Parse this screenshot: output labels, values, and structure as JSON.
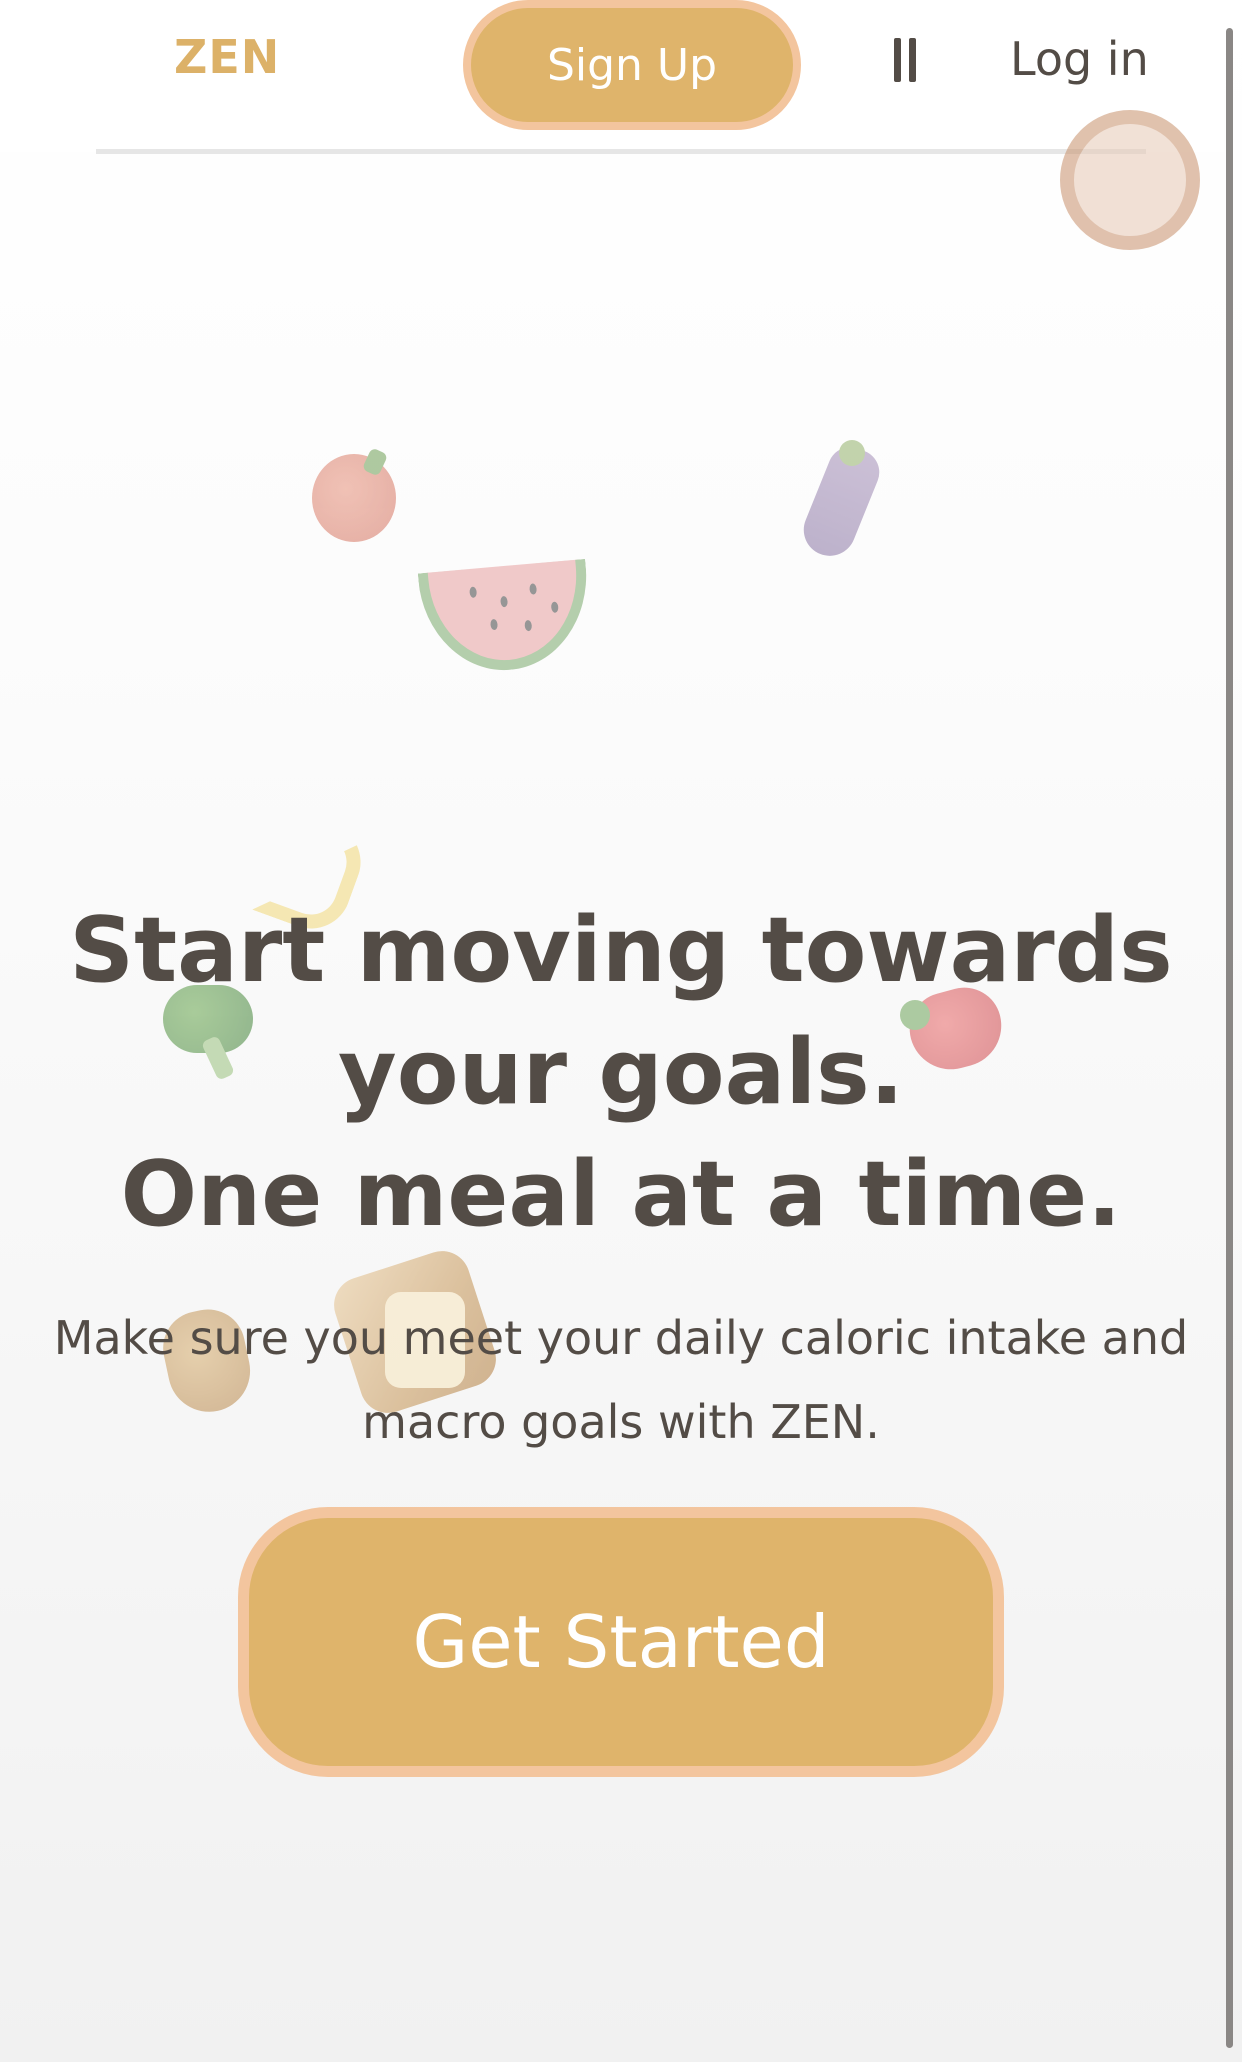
{
  "header": {
    "brand": "ZEN",
    "signup_label": "Sign Up",
    "login_label": "Log in"
  },
  "hero": {
    "title_line1": "Start moving towards",
    "title_line2": "your goals.",
    "title_line3": "One meal at a time.",
    "subtitle": "Make sure you meet your daily caloric intake and macro goals with ZEN.",
    "cta_label": "Get Started"
  },
  "icons": {
    "pause": "pause-icon",
    "foods": [
      "donut",
      "tomato",
      "eggplant",
      "watermelon",
      "banana",
      "broccoli",
      "strawberry",
      "potato",
      "bread"
    ]
  },
  "colors": {
    "accent": "#dfb46b",
    "accent_border": "#f3c59e",
    "brand": "#dcb168",
    "text": "#534c46"
  }
}
